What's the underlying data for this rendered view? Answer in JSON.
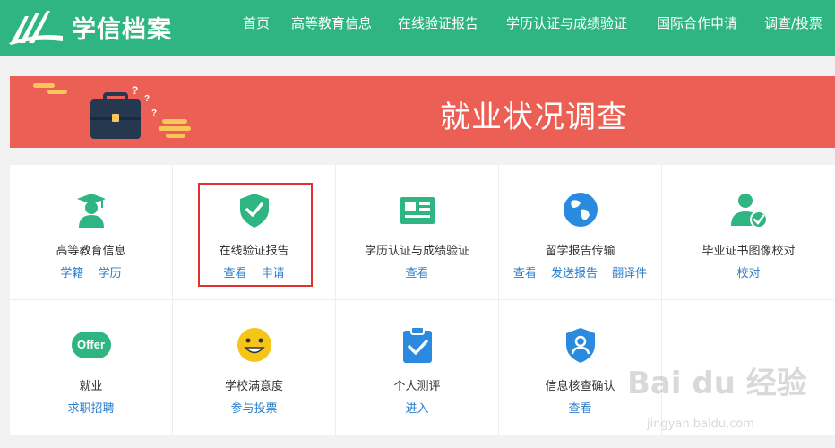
{
  "header": {
    "logo_text": "学信档案",
    "nav": [
      {
        "label": "首页"
      },
      {
        "label": "高等教育信息"
      },
      {
        "label": "在线验证报告"
      },
      {
        "label": "学历认证与成绩验证"
      },
      {
        "label": "国际合作申请"
      },
      {
        "label": "调查/投票"
      }
    ]
  },
  "banner": {
    "title": "就业状况调查"
  },
  "services": [
    {
      "title": "高等教育信息",
      "links": [
        "学籍",
        "学历"
      ],
      "icon": "graduate-icon"
    },
    {
      "title": "在线验证报告",
      "links": [
        "查看",
        "申请"
      ],
      "icon": "shield-check-icon"
    },
    {
      "title": "学历认证与成绩验证",
      "links": [
        "查看"
      ],
      "icon": "certificate-card-icon"
    },
    {
      "title": "留学报告传输",
      "links": [
        "查看",
        "发送报告",
        "翻译件"
      ],
      "icon": "globe-icon"
    },
    {
      "title": "毕业证书图像校对",
      "links": [
        "校对"
      ],
      "icon": "user-check-icon"
    },
    {
      "title": "就业",
      "links": [
        "求职招聘"
      ],
      "icon": "offer-icon",
      "icon_text": "Offer"
    },
    {
      "title": "学校满意度",
      "links": [
        "参与投票"
      ],
      "icon": "smiley-icon"
    },
    {
      "title": "个人测评",
      "links": [
        "进入"
      ],
      "icon": "clipboard-check-icon"
    },
    {
      "title": "信息核查确认",
      "links": [
        "查看"
      ],
      "icon": "shield-user-icon"
    },
    {
      "title": "",
      "links": [],
      "icon": ""
    }
  ],
  "watermark": {
    "main": "Bai du 经验",
    "sub": "jingyan.baidu.com"
  }
}
